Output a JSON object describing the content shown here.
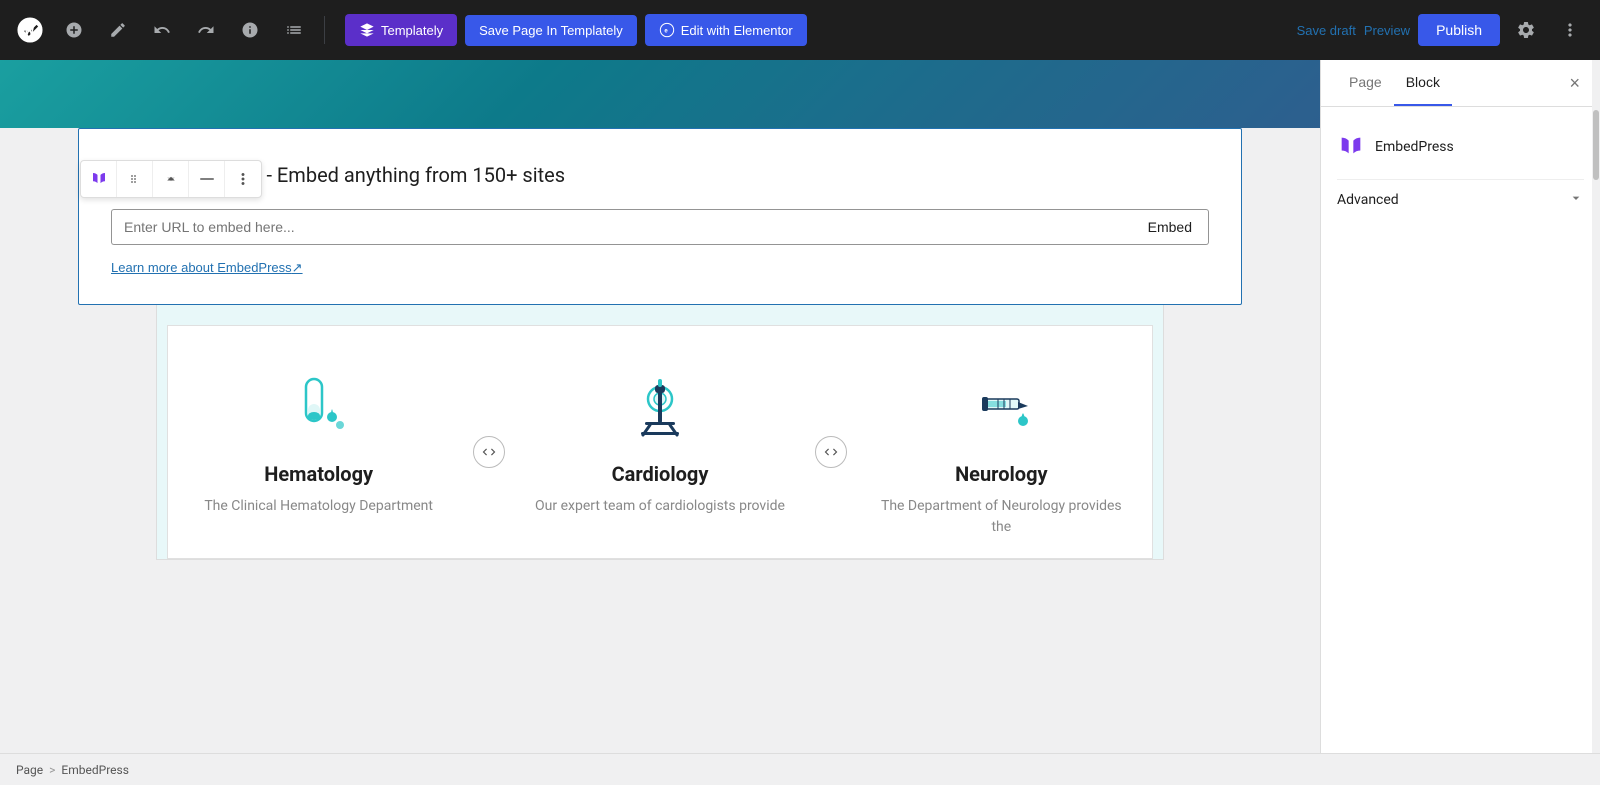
{
  "toolbar": {
    "add_label": "+",
    "save_draft_label": "Save draft",
    "preview_label": "Preview",
    "publish_label": "Publish",
    "templately_label": "Templately",
    "save_page_label": "Save Page In Templately",
    "elementor_label": "Edit with Elementor"
  },
  "sidebar": {
    "tab_page": "Page",
    "tab_block": "Block",
    "embedpress_label": "EmbedPress",
    "advanced_label": "Advanced",
    "close_label": "×"
  },
  "embedpress_block": {
    "title": "EmbedPress - Embed anything from 150+ sites",
    "input_placeholder": "Enter URL to embed here...",
    "embed_button": "Embed",
    "learn_more": "Learn more about EmbedPress"
  },
  "medical_cards": [
    {
      "title": "Hematology",
      "desc": "The Clinical Hematology Department"
    },
    {
      "title": "Cardiology",
      "desc": "Our expert team of cardiologists provide"
    },
    {
      "title": "Neurology",
      "desc": "The Department of Neurology provides the"
    }
  ],
  "breadcrumb": {
    "page": "Page",
    "separator": ">",
    "current": "EmbedPress"
  }
}
